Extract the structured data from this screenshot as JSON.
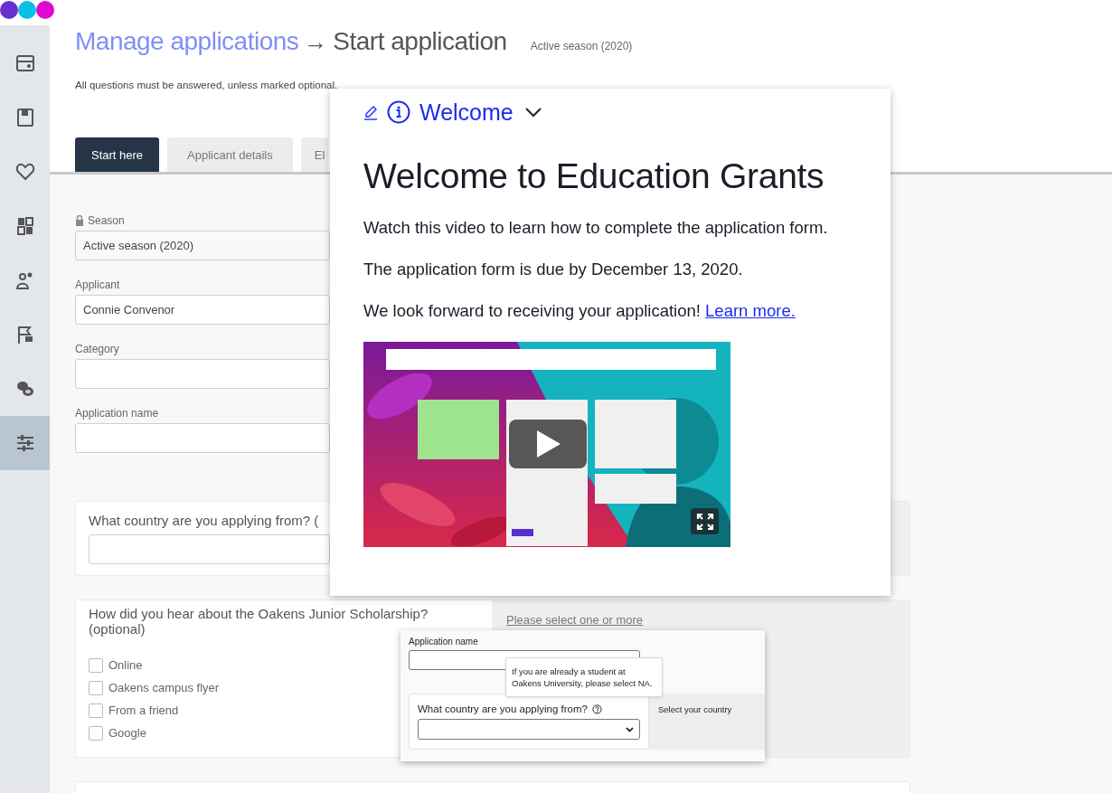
{
  "sidebar": {
    "items": [
      {
        "kind": "card",
        "selected": false
      },
      {
        "kind": "save",
        "selected": false
      },
      {
        "kind": "heart",
        "selected": false
      },
      {
        "kind": "grid",
        "selected": false
      },
      {
        "kind": "people",
        "selected": false
      },
      {
        "kind": "flag",
        "selected": false
      },
      {
        "kind": "coins",
        "selected": false
      },
      {
        "kind": "sliders",
        "selected": true
      }
    ]
  },
  "header": {
    "breadcrumb_link": "Manage applications",
    "arrow": "→",
    "title": "Start application",
    "season_dropdown": "Active season (2020)",
    "note": "All questions must be answered, unless marked optional."
  },
  "tabs": [
    {
      "label": "Start here",
      "selected": true
    },
    {
      "label": "Applicant details",
      "selected": false
    },
    {
      "label": "El",
      "selected": false
    }
  ],
  "form": {
    "fields": [
      {
        "label": "Season",
        "value": "Active season (2020)",
        "locked": true
      },
      {
        "label": "Applicant",
        "value": "Connie Convenor",
        "locked": false
      },
      {
        "label": "Category",
        "locked": false
      },
      {
        "label": "Application name",
        "locked": false
      }
    ],
    "questions": [
      {
        "kind": "text",
        "question": "What country are you applying from? ("
      },
      {
        "kind": "checkboxes",
        "question": "How did you hear about the Oakens Junior Scholarship? (optional)",
        "hint": "Please select one or more",
        "options": [
          {
            "label": "Online",
            "checked": false
          },
          {
            "label": "Oakens campus flyer",
            "checked": false
          },
          {
            "label": "From a friend",
            "checked": false
          },
          {
            "label": "Google",
            "checked": false
          }
        ]
      }
    ]
  },
  "welcome_panel": {
    "section": "Welcome",
    "heading": "Welcome to Education Grants",
    "paragraphs": [
      {
        "text": "Watch this video to learn how to complete the application form."
      },
      {
        "text": "The application form is due by December 13, 2020."
      },
      {
        "text": "We look forward to receiving your application!",
        "link": "Learn more."
      }
    ]
  },
  "field_preview": {
    "field_label": "Application name",
    "tooltip": "If you are already a student at Oakens University, please select NA.",
    "question": "What country are you applying from?",
    "hint": "Select your country"
  }
}
